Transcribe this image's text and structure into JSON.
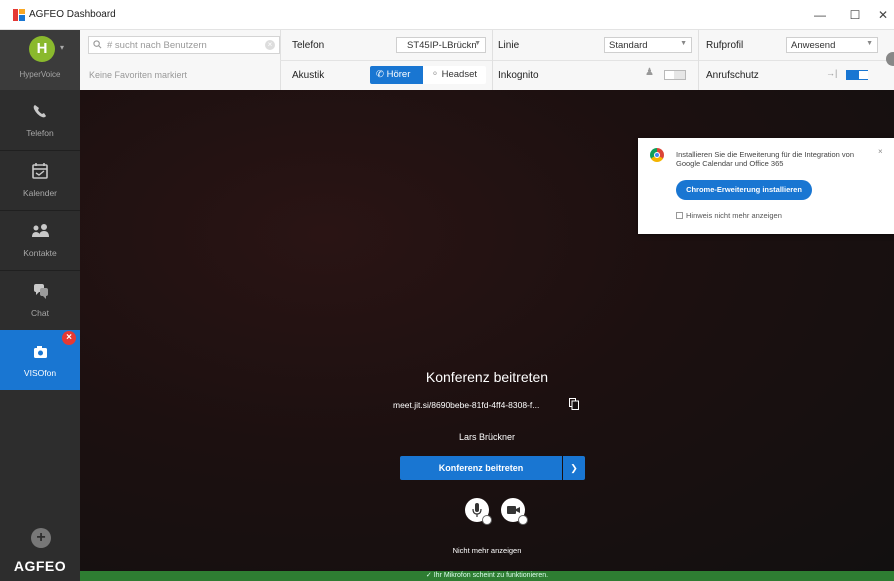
{
  "window": {
    "title": "AGFEO Dashboard",
    "minimize": "—",
    "maximize": "☐",
    "close": "✕"
  },
  "sidebar": {
    "avatar_letter": "H",
    "account_label": "HyperVoice",
    "items": [
      {
        "label": "Telefon",
        "icon": "phone-icon"
      },
      {
        "label": "Kalender",
        "icon": "calendar-icon"
      },
      {
        "label": "Kontakte",
        "icon": "contacts-icon"
      },
      {
        "label": "Chat",
        "icon": "chat-icon"
      },
      {
        "label": "VISOfon",
        "icon": "camera-icon",
        "active": true,
        "badge": "×"
      }
    ],
    "add_label": "+",
    "brand": "AGFEO"
  },
  "topbar": {
    "search_placeholder": "# sucht nach Benutzern",
    "favorites_note": "Keine Favoriten markiert",
    "telefon_label": "Telefon",
    "telefon_value": "ST45IP-LBrückn",
    "linie_label": "Linie",
    "linie_value": "Standard",
    "rufprofil_label": "Rufprofil",
    "rufprofil_value": "Anwesend",
    "akustik_label": "Akustik",
    "hoerer_label": "Hörer",
    "headset_label": "Headset",
    "inkognito_label": "Inkognito",
    "inkognito_on": false,
    "anrufschutz_label": "Anrufschutz",
    "anrufschutz_on": true
  },
  "conference": {
    "title": "Konferenz beitreten",
    "link": "meet.jit.si/8690bebe-81fd-4ff4-8308-f...",
    "name": "Lars Brückner",
    "join_label": "Konferenz beitreten",
    "dont_show": "Nicht mehr anzeigen"
  },
  "popup": {
    "message": "Installieren Sie die Erweiterung für die Integration von Google Calendar und Office 365",
    "button_label": "Chrome-Erweiterung installieren",
    "checkbox_label": "Hinweis nicht mehr anzeigen",
    "close": "×"
  },
  "status": {
    "message": "✓  Ihr Mikrofon scheint zu funktionieren."
  },
  "colors": {
    "accent": "#1976d2",
    "sidebar": "#2d2d2d",
    "status_ok": "#2e7d32",
    "badge": "#e53935"
  }
}
